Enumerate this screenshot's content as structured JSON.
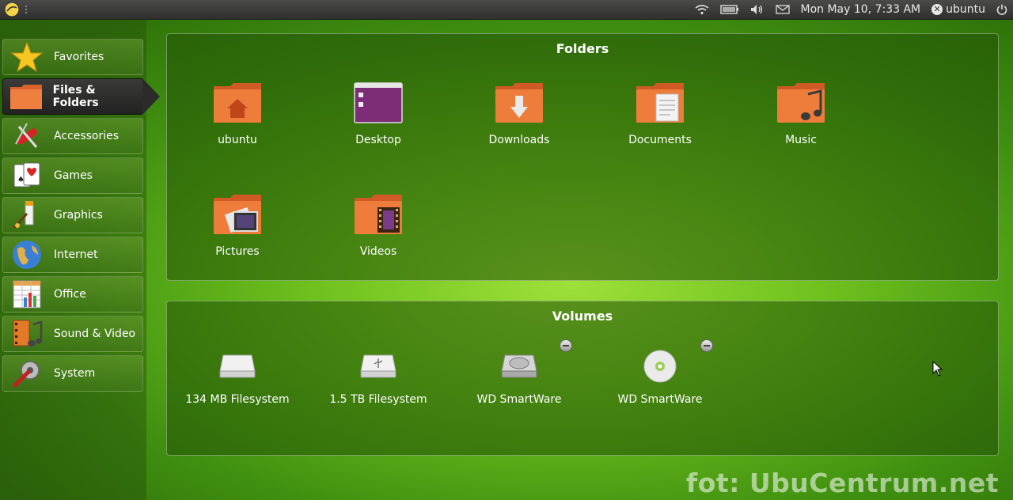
{
  "top_panel": {
    "datetime": "Mon May 10,  7:33 AM",
    "user": "ubuntu",
    "icons": [
      "ubuntu-logo-icon",
      "wifi-icon",
      "battery-icon",
      "volume-icon",
      "mail-icon",
      "user-icon",
      "power-icon"
    ]
  },
  "sidebar": {
    "items": [
      {
        "label": "Favorites",
        "icon": "star-icon"
      },
      {
        "label": "Files & Folders",
        "icon": "folder-icon",
        "active": true
      },
      {
        "label": "Accessories",
        "icon": "swiss-knife-icon"
      },
      {
        "label": "Games",
        "icon": "cards-icon"
      },
      {
        "label": "Graphics",
        "icon": "brush-icon"
      },
      {
        "label": "Internet",
        "icon": "globe-icon"
      },
      {
        "label": "Office",
        "icon": "spreadsheet-icon"
      },
      {
        "label": "Sound & Video",
        "icon": "media-icon"
      },
      {
        "label": "System",
        "icon": "wrench-icon"
      }
    ]
  },
  "folders": {
    "title": "Folders",
    "items": [
      {
        "label": "ubuntu",
        "icon": "home-folder-icon"
      },
      {
        "label": "Desktop",
        "icon": "desktop-icon"
      },
      {
        "label": "Downloads",
        "icon": "downloads-folder-icon"
      },
      {
        "label": "Documents",
        "icon": "documents-folder-icon"
      },
      {
        "label": "Music",
        "icon": "music-folder-icon"
      },
      {
        "label": "Pictures",
        "icon": "pictures-folder-icon"
      },
      {
        "label": "Videos",
        "icon": "videos-folder-icon"
      }
    ]
  },
  "volumes": {
    "title": "Volumes",
    "items": [
      {
        "label": "134 MB Filesystem",
        "icon": "drive-icon"
      },
      {
        "label": "1.5 TB Filesystem",
        "icon": "usb-drive-icon"
      },
      {
        "label": "WD SmartWare",
        "icon": "harddisk-icon",
        "ejectable": true
      },
      {
        "label": "WD SmartWare",
        "icon": "cdrom-icon",
        "ejectable": true
      }
    ]
  },
  "watermark": "fot: UbuCentrum.net",
  "colors": {
    "accent_green": "#6fc21e",
    "folder_orange": "#e8743a",
    "panel_dark": "#2f2f2d"
  }
}
